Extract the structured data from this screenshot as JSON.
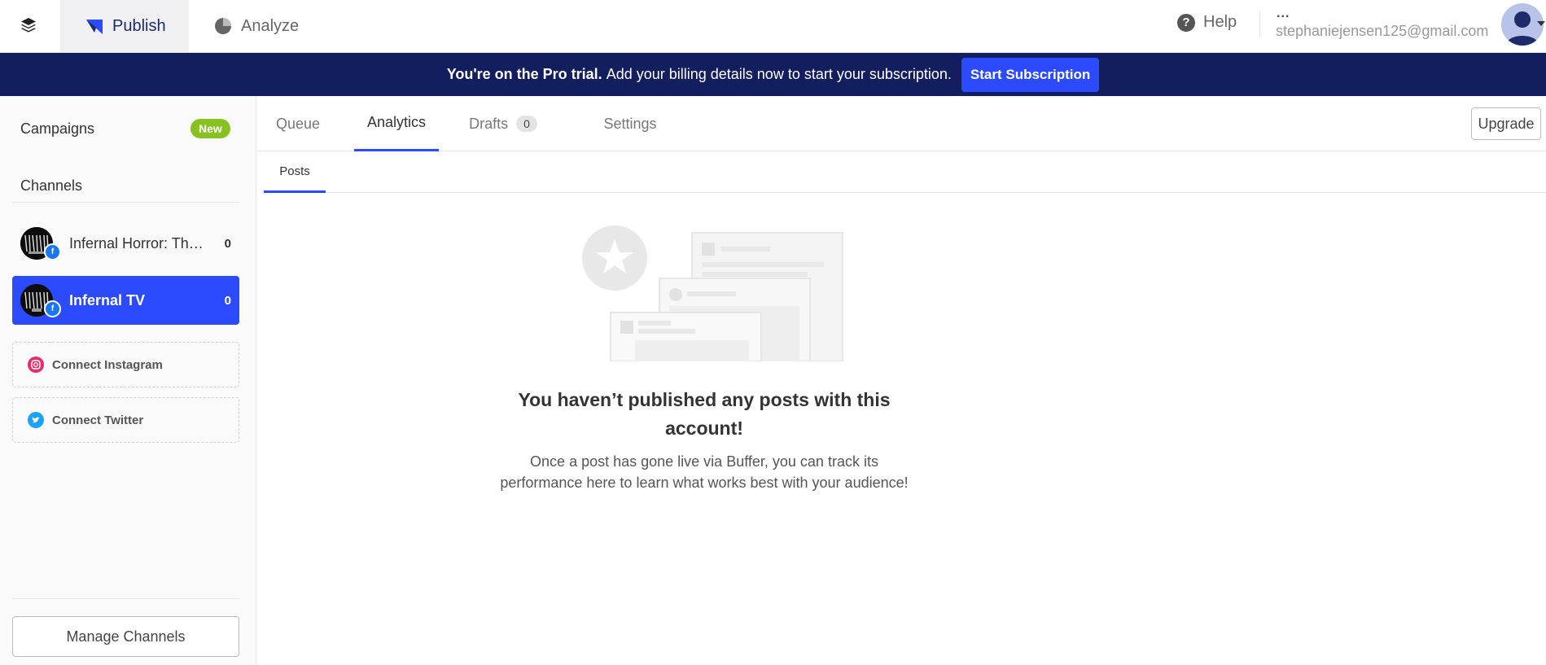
{
  "topbar": {
    "nav": [
      {
        "label": "Publish",
        "icon": "publish-icon",
        "active": true
      },
      {
        "label": "Analyze",
        "icon": "pie-chart-icon",
        "active": false
      }
    ],
    "help_label": "Help",
    "user_dots": "...",
    "user_email": "stephaniejensen125@gmail.com"
  },
  "banner": {
    "bold_text": "You're on the Pro trial.",
    "text": "Add your billing details now to start your subscription.",
    "button_label": "Start Subscription",
    "background": "#121e5e",
    "button_color": "#2c4bff"
  },
  "sidebar": {
    "campaigns_label": "Campaigns",
    "campaigns_badge": "New",
    "channels_label": "Channels",
    "channels": [
      {
        "name": "Infernal Horror: The ...",
        "count": "0",
        "network": "facebook",
        "active": false
      },
      {
        "name": "Infernal TV",
        "count": "0",
        "network": "facebook",
        "active": true
      }
    ],
    "connect": [
      {
        "label": "Connect Instagram",
        "icon": "instagram-icon"
      },
      {
        "label": "Connect Twitter",
        "icon": "twitter-icon"
      }
    ],
    "manage_button": "Manage Channels"
  },
  "main": {
    "tabs": [
      {
        "label": "Queue",
        "active": false
      },
      {
        "label": "Analytics",
        "active": true
      },
      {
        "label": "Drafts",
        "count": "0",
        "active": false
      },
      {
        "label": "Settings",
        "active": false
      }
    ],
    "upgrade_button": "Upgrade",
    "subtabs": [
      {
        "label": "Posts",
        "active": true
      }
    ],
    "empty_state": {
      "title": "You haven’t published any posts with this account!",
      "description": "Once a post has gone live via Buffer, you can track its performance here to learn what works best with your audience!"
    }
  },
  "colors": {
    "accent": "#2c4bff",
    "new_badge": "#87c221",
    "facebook": "#1877f2",
    "instagram": "#e1306c",
    "twitter": "#1da1f2"
  }
}
